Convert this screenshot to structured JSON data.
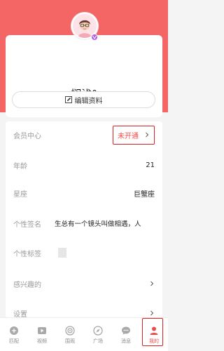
{
  "profile": {
    "nickname": "搁浅°",
    "avatar_icon": "avatar-icon",
    "badge_icon": "vip-badge-icon",
    "edit_label": "编辑资料"
  },
  "rows": {
    "member": {
      "label": "会员中心",
      "status": "未开通"
    },
    "age": {
      "label": "年龄",
      "value": "21"
    },
    "zodiac": {
      "label": "星座",
      "value": "巨蟹座"
    },
    "signature": {
      "label": "个性签名",
      "value": "生总有一个镜头叫做相遇，人"
    },
    "tags": {
      "label": "个性标签"
    },
    "interests": {
      "label": "感兴趣的"
    },
    "settings": {
      "label": "设置"
    }
  },
  "nav": [
    {
      "label": "匹配",
      "icon": "match-icon"
    },
    {
      "label": "视频",
      "icon": "video-icon"
    },
    {
      "label": "围观",
      "icon": "watch-icon"
    },
    {
      "label": "广场",
      "icon": "square-icon"
    },
    {
      "label": "消息",
      "icon": "message-icon"
    },
    {
      "label": "我的",
      "icon": "profile-icon"
    }
  ],
  "colors": {
    "accent": "#f46565",
    "highlight_border": "#e02020",
    "status_text": "#f04b4b"
  }
}
